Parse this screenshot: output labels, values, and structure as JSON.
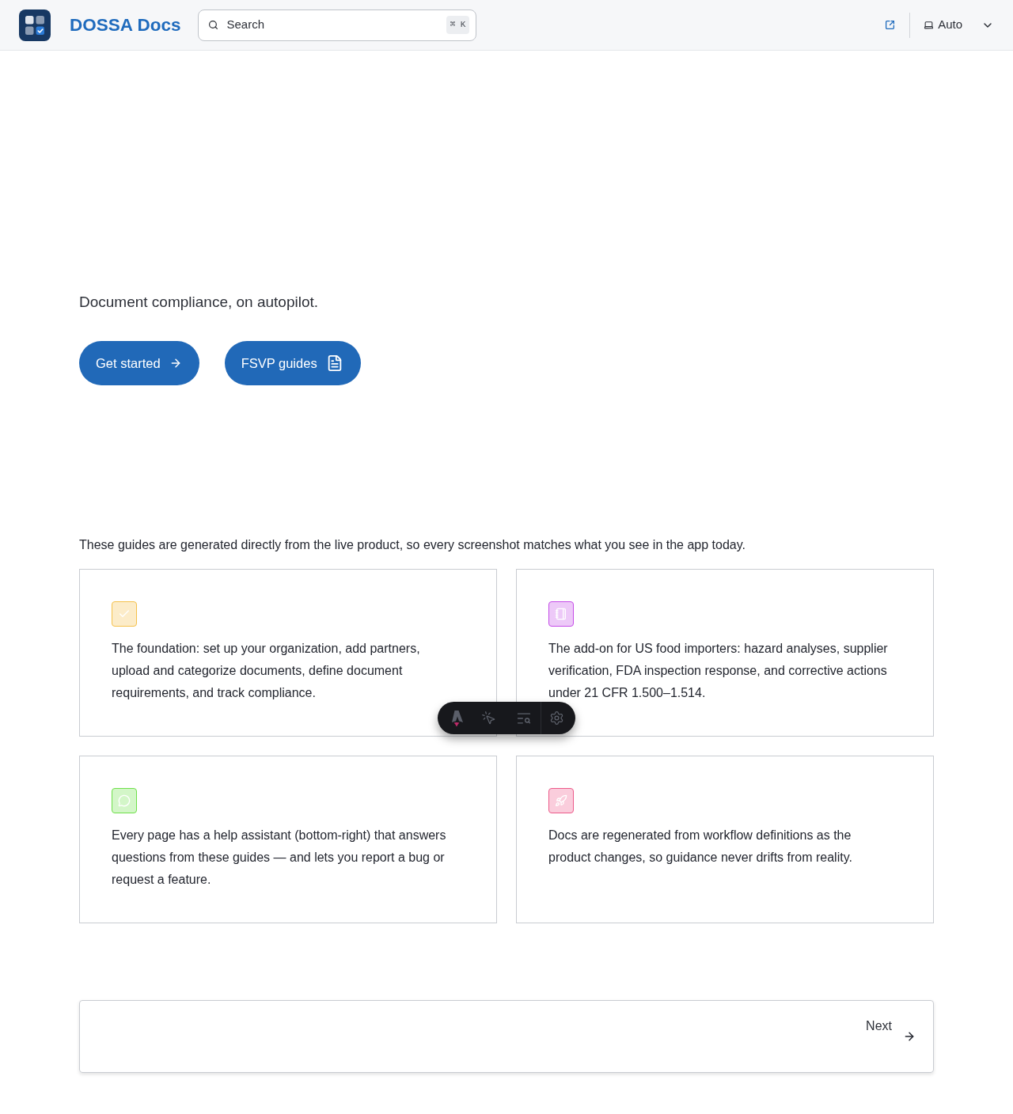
{
  "header": {
    "title": "DOSSA Docs",
    "search": {
      "placeholder": "Search",
      "shortcut": "⌘ K"
    },
    "theme_select": {
      "value": "Auto"
    }
  },
  "hero": {
    "tagline": "Document compliance, on autopilot.",
    "actions": [
      {
        "label": "Get started",
        "kind": "arrow"
      },
      {
        "label": "FSVP guides",
        "kind": "document"
      }
    ]
  },
  "intro": "These guides are generated directly from the live product, so every screenshot matches what you see in the app today.",
  "cards": [
    {
      "text": "The foundation: set up your organization, add partners, upload and categorize documents, define document requirements, and track compliance.",
      "color": "#f5c14b"
    },
    {
      "text": "The add-on for US food importers: hazard analyses, supplier verification, FDA inspection response, and corrective actions under 21 CFR 1.500–1.514.",
      "color": "#c54be8"
    },
    {
      "text": "Every page has a help assistant (bottom-right) that answers questions from these guides — and lets you report a bug or request a feature.",
      "color": "#6ee04a"
    },
    {
      "text": "Docs are regenerated from workflow definitions as the product changes, so guidance never drifts from reality.",
      "color": "#ed5a8a"
    }
  ],
  "pagination": {
    "next": {
      "label": "Next"
    }
  }
}
